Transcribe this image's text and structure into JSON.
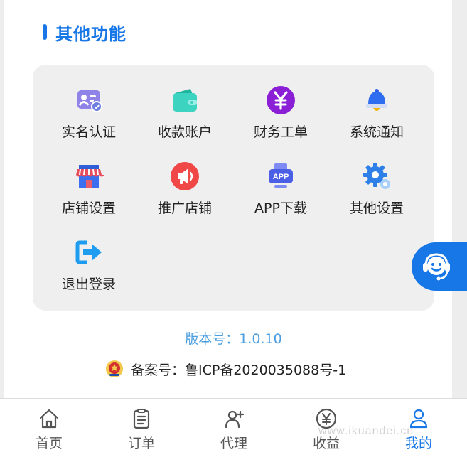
{
  "section": {
    "title": "其他功能"
  },
  "menu_items": [
    {
      "label": "实名认证",
      "icon": "id-card-icon"
    },
    {
      "label": "收款账户",
      "icon": "wallet-icon"
    },
    {
      "label": "财务工单",
      "icon": "yen-circle-icon"
    },
    {
      "label": "系统通知",
      "icon": "bell-icon"
    },
    {
      "label": "店铺设置",
      "icon": "shop-icon"
    },
    {
      "label": "推广店铺",
      "icon": "megaphone-icon"
    },
    {
      "label": "APP下载",
      "icon": "app-download-icon"
    },
    {
      "label": "其他设置",
      "icon": "gear-icon"
    },
    {
      "label": "退出登录",
      "icon": "logout-arrow-icon"
    }
  ],
  "version": "版本号：1.0.10",
  "icp": "备案号：鲁ICP备2020035088号-1",
  "tabbar": [
    {
      "label": "首页",
      "icon": "home-icon"
    },
    {
      "label": "订单",
      "icon": "clipboard-icon"
    },
    {
      "label": "代理",
      "icon": "add-person-icon"
    },
    {
      "label": "收益",
      "icon": "yen-circle-outline-icon"
    },
    {
      "label": "我的",
      "icon": "user-icon",
      "active": true
    }
  ],
  "watermark": "www.ikuandei.cn",
  "colors": {
    "accent": "#1877e6",
    "version_text": "#4a9ee0",
    "card_bg": "#efefef"
  }
}
